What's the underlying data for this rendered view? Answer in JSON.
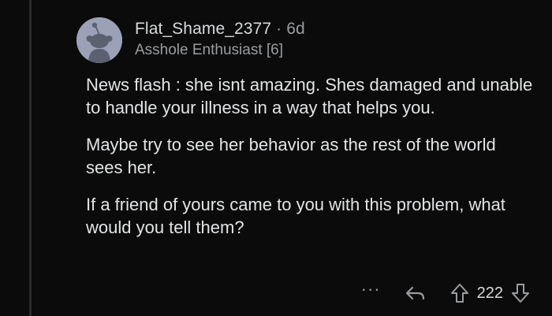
{
  "comment": {
    "username": "Flat_Shame_2377",
    "separator": "·",
    "age": "6d",
    "flair": "Asshole Enthusiast [6]",
    "paragraphs": [
      "News flash : she isnt amazing. Shes damaged and unable to handle your illness in a way that helps you.",
      "Maybe try to see her behavior as the rest of the world sees her.",
      "If a friend of yours came to you with this problem, what would you tell them?"
    ],
    "actions": {
      "more_label": "···",
      "score": "222"
    }
  },
  "icons": {
    "avatar": "snoo-avatar-icon",
    "reply": "reply-arrow-icon",
    "upvote": "upvote-arrow-icon",
    "downvote": "downvote-arrow-icon"
  },
  "colors": {
    "background": "#0b0b0b",
    "avatar_bg": "#9ba2b8",
    "text": "#d7dadc",
    "muted": "#9a9da0"
  }
}
